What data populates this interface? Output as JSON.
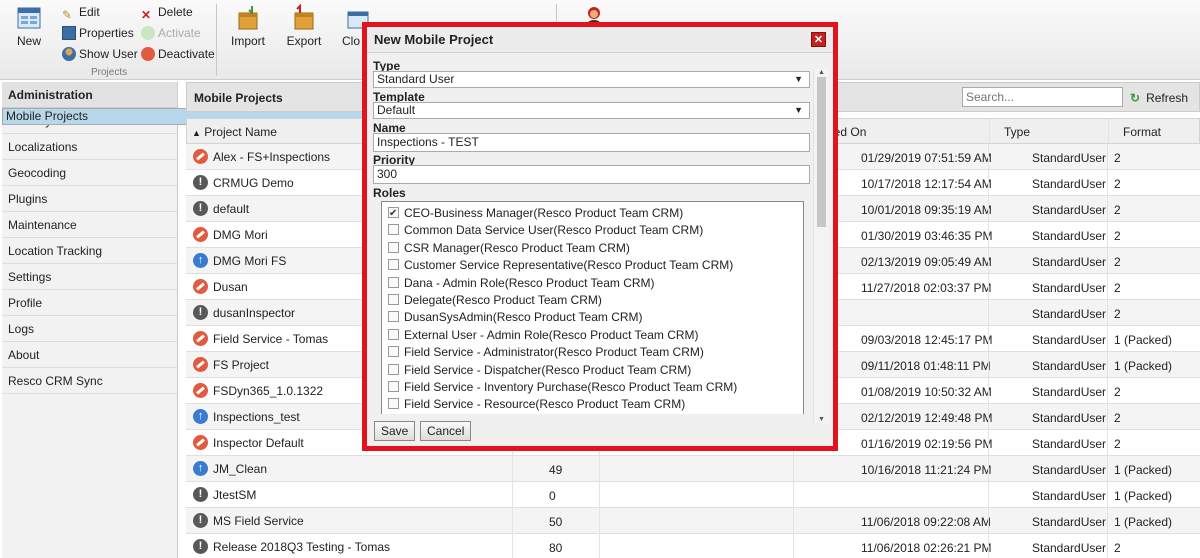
{
  "toolbar": {
    "new_label": "New",
    "edit_label": "Edit",
    "delete_label": "Delete",
    "properties_label": "Properties",
    "activate_label": "Activate",
    "show_user_label": "Show User",
    "deactivate_label": "Deactivate",
    "group_label": "Projects",
    "import_label": "Import",
    "export_label": "Export",
    "clone_label": "Clo"
  },
  "sidebar": {
    "header": "Administration",
    "items": [
      {
        "label": "Mobile Projects",
        "selected": true
      },
      {
        "label": "Security"
      },
      {
        "label": "Localizations"
      },
      {
        "label": "Geocoding"
      },
      {
        "label": "Plugins"
      },
      {
        "label": "Maintenance"
      },
      {
        "label": "Location Tracking"
      },
      {
        "label": "Settings"
      },
      {
        "label": "Profile"
      },
      {
        "label": "Logs"
      },
      {
        "label": "About"
      },
      {
        "label": "Resco CRM Sync"
      }
    ]
  },
  "main": {
    "title": "Mobile Projects",
    "search_placeholder": "Search...",
    "refresh_label": "Refresh",
    "columns": {
      "name": "Project Name",
      "published": "hed On",
      "type": "Type",
      "format": "Format"
    },
    "rows": [
      {
        "status": "error",
        "name": "Alex - FS+Inspections",
        "count": "",
        "published": "01/29/2019 07:51:59 AM",
        "type": "StandardUser",
        "format": "2"
      },
      {
        "status": "warn",
        "name": "CRMUG Demo",
        "count": "",
        "published": "10/17/2018 12:17:54 AM",
        "type": "StandardUser",
        "format": "2"
      },
      {
        "status": "warn",
        "name": "default",
        "count": "",
        "published": "10/01/2018 09:35:19 AM",
        "type": "StandardUser",
        "format": "2"
      },
      {
        "status": "error",
        "name": "DMG Mori",
        "count": "",
        "published": "01/30/2019 03:46:35 PM",
        "type": "StandardUser",
        "format": "2"
      },
      {
        "status": "up",
        "name": "DMG Mori FS",
        "count": "",
        "published": "02/13/2019 09:05:49 AM",
        "type": "StandardUser",
        "format": "2"
      },
      {
        "status": "error",
        "name": "Dusan",
        "count": "",
        "published": "11/27/2018 02:03:37 PM",
        "type": "StandardUser",
        "format": "2"
      },
      {
        "status": "warn",
        "name": "dusanInspector",
        "count": "",
        "published": "",
        "type": "StandardUser",
        "format": "2"
      },
      {
        "status": "error",
        "name": "Field Service - Tomas",
        "count": "",
        "published": "09/03/2018 12:45:17 PM",
        "type": "StandardUser",
        "format": "1 (Packed)"
      },
      {
        "status": "error",
        "name": "FS Project",
        "count": "",
        "published": "09/11/2018 01:48:11 PM",
        "type": "StandardUser",
        "format": "1 (Packed)"
      },
      {
        "status": "error",
        "name": "FSDyn365_1.0.1322",
        "count": "",
        "published": "01/08/2019 10:50:32 AM",
        "type": "StandardUser",
        "format": "2"
      },
      {
        "status": "up",
        "name": "Inspections_test",
        "count": "",
        "published": "02/12/2019 12:49:48 PM",
        "type": "StandardUser",
        "format": "2"
      },
      {
        "status": "error",
        "name": "Inspector Default",
        "count": "",
        "published": "01/16/2019 02:19:56 PM",
        "type": "StandardUser",
        "format": "2"
      },
      {
        "status": "up",
        "name": "JM_Clean",
        "count": "49",
        "published": "10/16/2018 11:21:24 PM",
        "type": "StandardUser",
        "format": "1 (Packed)"
      },
      {
        "status": "warn",
        "name": "JtestSM",
        "count": "0",
        "published": "",
        "type": "StandardUser",
        "format": "1 (Packed)"
      },
      {
        "status": "warn",
        "name": "MS Field Service",
        "count": "50",
        "published": "11/06/2018 09:22:08 AM",
        "type": "StandardUser",
        "format": "1 (Packed)"
      },
      {
        "status": "warn",
        "name": "Release 2018Q3 Testing - Tomas",
        "count": "80",
        "published": "11/06/2018 02:26:21 PM",
        "type": "StandardUser",
        "format": "2"
      }
    ]
  },
  "dialog": {
    "title": "New Mobile Project",
    "close_label": "✕",
    "type_label": "Type",
    "type_value": "Standard User",
    "template_label": "Template",
    "template_value": "Default",
    "name_label": "Name",
    "name_value": "Inspections - TEST",
    "priority_label": "Priority",
    "priority_value": "300",
    "roles_label": "Roles",
    "roles": [
      {
        "label": "CEO-Business Manager(Resco Product Team CRM)",
        "checked": true
      },
      {
        "label": "Common Data Service User(Resco Product Team CRM)",
        "checked": false
      },
      {
        "label": "CSR Manager(Resco Product Team CRM)",
        "checked": false
      },
      {
        "label": "Customer Service Representative(Resco Product Team CRM)",
        "checked": false
      },
      {
        "label": "Dana - Admin Role(Resco Product Team CRM)",
        "checked": false
      },
      {
        "label": "Delegate(Resco Product Team CRM)",
        "checked": false
      },
      {
        "label": "DusanSysAdmin(Resco Product Team CRM)",
        "checked": false
      },
      {
        "label": "External User - Admin Role(Resco Product Team CRM)",
        "checked": false
      },
      {
        "label": "Field Service - Administrator(Resco Product Team CRM)",
        "checked": false
      },
      {
        "label": "Field Service - Dispatcher(Resco Product Team CRM)",
        "checked": false
      },
      {
        "label": "Field Service - Inventory Purchase(Resco Product Team CRM)",
        "checked": false
      },
      {
        "label": "Field Service - Resource(Resco Product Team CRM)",
        "checked": false
      }
    ],
    "save_label": "Save",
    "cancel_label": "Cancel"
  },
  "colors": {
    "highlight_border": "#e2131d",
    "selected_nav": "#b7d7ea",
    "status_error": "#e25a3f",
    "status_warn": "#585858",
    "status_up": "#3a7ad0"
  }
}
